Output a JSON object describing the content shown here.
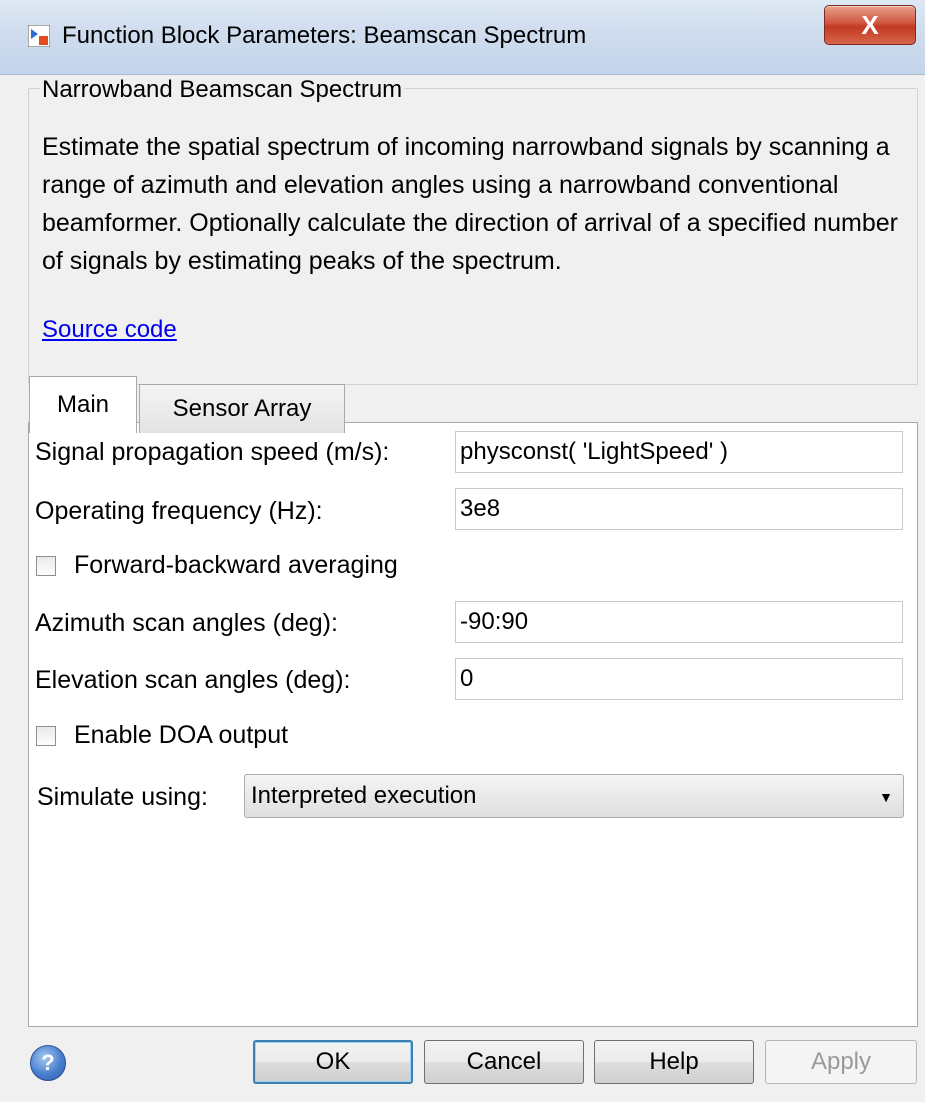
{
  "window": {
    "title": "Function Block Parameters: Beamscan Spectrum",
    "close_symbol": "X"
  },
  "description": {
    "group_title": "Narrowband Beamscan Spectrum",
    "text": "Estimate the spatial spectrum of incoming narrowband signals by scanning a range of azimuth and elevation angles using a narrowband conventional beamformer. Optionally calculate the direction of arrival of a specified number of signals by estimating peaks of the spectrum.",
    "link": "Source code"
  },
  "tabs": [
    {
      "label": "Main",
      "active": true
    },
    {
      "label": "Sensor Array",
      "active": false
    }
  ],
  "params": {
    "propagation_speed_label": "Signal propagation speed (m/s):",
    "propagation_speed_value": "physconst( 'LightSpeed' )",
    "operating_freq_label": "Operating frequency (Hz):",
    "operating_freq_value": "3e8",
    "fb_averaging_label": "Forward-backward averaging",
    "fb_averaging_checked": false,
    "azimuth_label": "Azimuth scan angles (deg):",
    "azimuth_value": "-90:90",
    "elevation_label": "Elevation scan angles (deg):",
    "elevation_value": "0",
    "doa_label": "Enable DOA output",
    "doa_checked": false,
    "simulate_label": "Simulate using:",
    "simulate_value": "Interpreted execution"
  },
  "buttons": {
    "ok": "OK",
    "cancel": "Cancel",
    "help": "Help",
    "apply": "Apply",
    "help_icon": "?"
  },
  "icons": {
    "app_icon": "simulink-block-icon",
    "help_icon": "help-circle-icon",
    "dropdown": "chevron-down-icon"
  },
  "colors": {
    "link": "#0000ee",
    "close_button": "#c23a22",
    "default_button_border": "#3c7fb1"
  }
}
